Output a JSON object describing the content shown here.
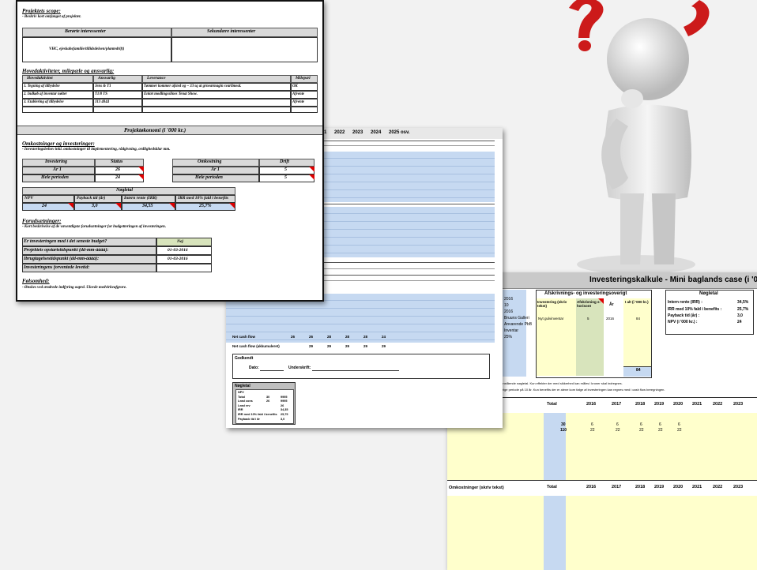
{
  "doc1": {
    "s1_title": "Projektets scope:",
    "s1_note": "- Beskriv kort omfanget af projektet.",
    "col_a": "Berørte interessenter",
    "col_b": "Sekundære interessenter",
    "s1_cell": "VHC, ejeskabsfamilie/tillidsdelsen/plantedrift)",
    "s2_title": "Hovedaktiviteter, milepæle og ansvarlig:",
    "act_headers": [
      "Hovedaktivitet",
      "Ansvarlig",
      "Leverance",
      "Milepæl"
    ],
    "activities": [
      [
        "1. Tegning af tilbydelse",
        "Jens & T1",
        "Tømmer kommer afsted og ~ 33 sq at grnearmagin svarlimeal.",
        "OK"
      ],
      [
        "2. Indkøb af inventar nølter",
        "T1/8 TS",
        "Enlæt modlingsslines Tenat Show.",
        "Afvente"
      ],
      [
        "3. Etablering af tilbydelse",
        "J13 4044",
        "",
        "Afvente"
      ]
    ],
    "s3_header": "Projektøkonomi (i '000 kr.)",
    "s3_title": "Omkostninger og investeringer:",
    "s3_note": "- Investeringsbehov inkl. omkostninger til implementering, rådgivning, ordlighedsklar mm.",
    "inv_table": {
      "h1": "Investering",
      "h2": "Status",
      "h3": "Omkostning",
      "h4": "Drift",
      "r1l": "År 1",
      "r1v": "26",
      "r1l2": "År 1",
      "r1v2": "5",
      "r2l": "Hele perioden",
      "r2v": "24",
      "r2l2": "Hele perioden",
      "r2v2": "5"
    },
    "kpi_title": "Nøgletal",
    "kpi_headers": [
      "NPV",
      "Payback tid (år)",
      "Intern rente (IRR)",
      "IRR med 10% fald i benefits"
    ],
    "kpi_values": [
      "24",
      "3,0",
      "34,55",
      "25,7%"
    ],
    "s4_title": "Forudsætninger:",
    "s4_note": "- Kort beskrivelse af de væsentligste forudsætninger for budgetteringen af investeringen.",
    "fields": [
      [
        "Er investeringen med i det seneste budget?",
        "Nej"
      ],
      [
        "Projektets opstartstidspunkt (dd-mm-åååå):",
        "01-03-2016"
      ],
      [
        "Ibrugtagelsestidspunkt (dd-mm-åååå):",
        "01-03-2016"
      ],
      [
        "Investeringens forventede levetid:",
        ""
      ]
    ],
    "s5_title": "Følsomhed:",
    "s5_note": "- Ønskes ved ændrede indfyring oaprd. Ulovde medvirkeafgrore."
  },
  "doc2": {
    "years": [
      "2017",
      "2018",
      "2019",
      "2020",
      "2021",
      "2022",
      "2023",
      "2024",
      "2025 osv."
    ],
    "row_net": "Net cash flow",
    "row_acc": "Net cash flow (akkumuleret)",
    "net_vals": [
      "26",
      "26",
      "28",
      "28",
      "28",
      "24"
    ],
    "acc_vals": [
      "29",
      "29",
      "29",
      "29",
      "29"
    ],
    "approval_title": "Godkendt",
    "approval_date": "Dato:",
    "approval_sign": "Underskrift:",
    "kpi_box_title": "Nøgletal",
    "kpi_rows": [
      [
        "NPV",
        "",
        ""
      ],
      [
        "Total",
        "30",
        "9995"
      ],
      [
        "Lead cons",
        "26",
        "9995"
      ],
      [
        "Lead rev",
        "",
        "26"
      ],
      [
        "IRR",
        "",
        "34,35"
      ],
      [
        "IRR med 10% fald i benefits",
        "",
        "25,75"
      ],
      [
        "Payback tid i år",
        "",
        "3,0"
      ]
    ]
  },
  "doc3": {
    "title": "Investeringskalkule - Mini baglands case (i '000 kr.)",
    "left_items": [
      "2016",
      "10",
      "2016",
      "Bruuns Galleri",
      "Anvarende PbB",
      "Inventar",
      "25%"
    ],
    "overview_title": "Afskrivnings- og investeringsoverigt",
    "ov_headers": [
      "Investering (skriv tekst)",
      "Afskrivning s-horisont",
      "År",
      "I alt (i '000 kr.)"
    ],
    "ov_row": [
      "Nyt gulvinventar",
      "5",
      "2016",
      "84"
    ],
    "ov_total": "84",
    "kpi_title": "Nøgletal",
    "kpi": [
      [
        "Intern rente (IRR) :",
        "34,5%"
      ],
      [
        "IRR med 10% fald i benefits :",
        "25,7%"
      ],
      [
        "Payback tid (år) :",
        "3,0"
      ],
      [
        "NPV (i '000 kr.) :",
        "24"
      ]
    ],
    "note1": "rives med indregnede effekter på nedenstående nøgletal. Kun effekter der med sikkerhed kan måles i kroner skal indregnes.",
    "note2": "mkostninger og benefits i løbet af en årige periode på 10 år. Kun benefits der er alene kom følge af investeringen kan regnes med i cash flow beregningen.",
    "table_headers": [
      "Total",
      "2016",
      "2017",
      "2018",
      "2019",
      "2020",
      "2021",
      "2022",
      "2023"
    ],
    "row_label": "på 31,50] timeshlag) - VHC |",
    "row_total_a": "30",
    "row_total_b": "110",
    "row_vals_a": [
      "6",
      "6",
      "6",
      "6",
      "6"
    ],
    "row_vals_b": [
      "22",
      "22",
      "22",
      "22",
      "22"
    ],
    "cost_header": "Omkostninger (skriv tekst)"
  }
}
